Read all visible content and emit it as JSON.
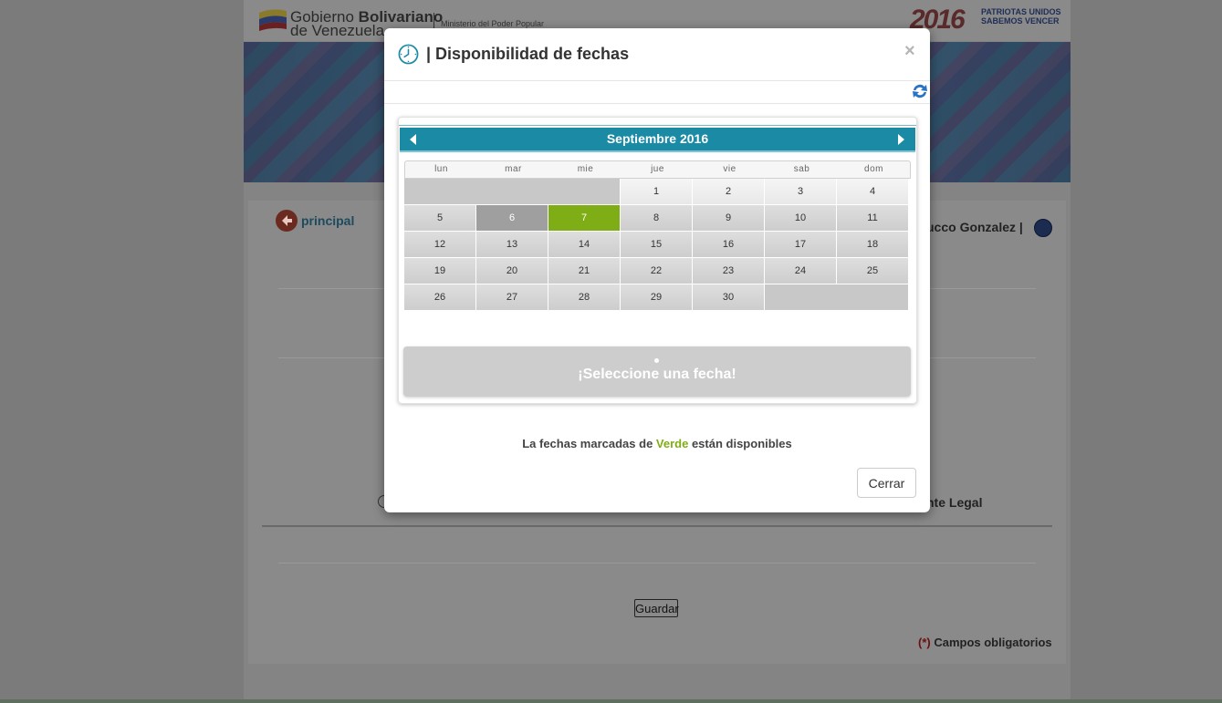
{
  "background": {
    "gov_name_part1": "Gobierno ",
    "gov_name_bold": "Bolivariano",
    "gov_name_line2": "de Venezuela",
    "ministry": "Ministerio del Poder Popular",
    "brand_year": "2016",
    "brand_slogan_line1": "PATRIOTAS UNIDOS",
    "brand_slogan_line2": "SABEMOS VENCER",
    "back_label": "principal",
    "user_name": "ucco Gonzalez |",
    "partial_label": "nte Legal",
    "save_label": "Guardar",
    "required_asterisk": "(*)",
    "required_label": " Campos obligatorios"
  },
  "modal": {
    "title": "| Disponibilidad de fechas",
    "close_symbol": "×",
    "calendar": {
      "month_label": "Septiembre 2016",
      "weekdays": [
        "lun",
        "mar",
        "mie",
        "jue",
        "vie",
        "sab",
        "dom"
      ],
      "weeks": [
        [
          "",
          "",
          "",
          "1",
          "2",
          "3",
          "4"
        ],
        [
          "5",
          "6",
          "7",
          "8",
          "9",
          "10",
          "11"
        ],
        [
          "12",
          "13",
          "14",
          "15",
          "16",
          "17",
          "18"
        ],
        [
          "19",
          "20",
          "21",
          "22",
          "23",
          "24",
          "25"
        ],
        [
          "26",
          "27",
          "28",
          "29",
          "30",
          "",
          ""
        ]
      ],
      "selected_day": "6",
      "available_days": [
        "7"
      ],
      "first_week_light_days": [
        "1",
        "2",
        "3",
        "4"
      ],
      "prompt": "¡Seleccione una fecha!"
    },
    "legend_prefix": "La fechas marcadas de ",
    "legend_highlight": "Verde",
    "legend_suffix": " están disponibles",
    "close_button": "Cerrar"
  },
  "colors": {
    "calendar_header": "#1a8aa5",
    "available_green": "#7fad15",
    "selected_gray": "#9f9f9f"
  }
}
